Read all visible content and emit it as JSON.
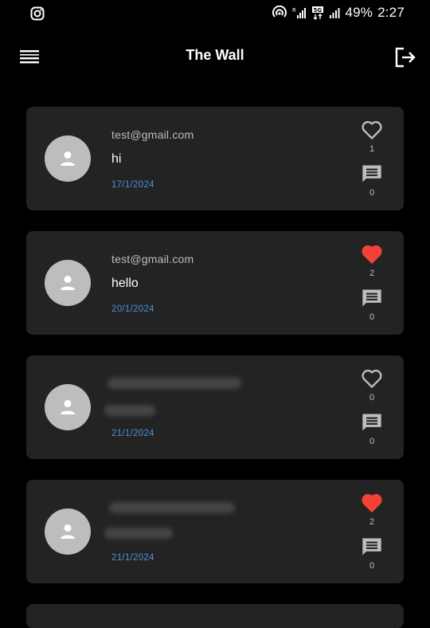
{
  "status_bar": {
    "battery": "49%",
    "time": "2:27",
    "network_label": "5G",
    "icons": [
      "instagram-icon",
      "hotspot-icon",
      "signal-icon",
      "5g-icon",
      "signal-icon",
      "battery"
    ]
  },
  "app_bar": {
    "title": "The Wall",
    "menu_icon": "menu-icon",
    "logout_icon": "logout-icon"
  },
  "colors": {
    "background": "#000000",
    "card": "#232323",
    "avatar": "#bdbdbd",
    "date": "#4a90d9",
    "liked_heart": "#f44336",
    "icon_gray": "#bdbdbd"
  },
  "posts": [
    {
      "email": "test@gmail.com",
      "message": "hi",
      "date": "17/1/2024",
      "liked": false,
      "likes": "1",
      "comments": "0"
    },
    {
      "email": "test@gmail.com",
      "message": "hello",
      "date": "20/1/2024",
      "liked": true,
      "likes": "2",
      "comments": "0"
    },
    {
      "email": "",
      "message": "",
      "redacted": true,
      "date": "21/1/2024",
      "liked": false,
      "likes": "0",
      "comments": "0"
    },
    {
      "email": "",
      "message": "",
      "redacted": true,
      "date": "21/1/2024",
      "liked": true,
      "likes": "2",
      "comments": "0"
    }
  ]
}
